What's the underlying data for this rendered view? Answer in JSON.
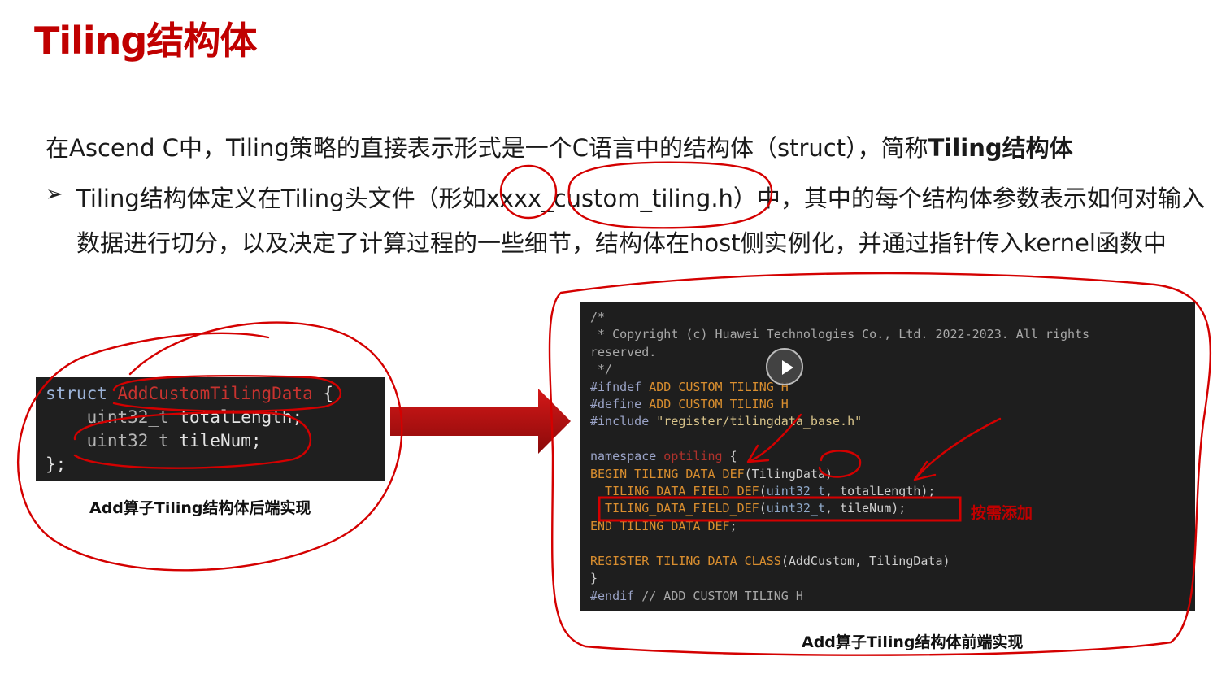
{
  "title": "Tiling结构体",
  "intro": {
    "prefix": "在Ascend C中，Tiling策略的直接表示形式是一个C语言中的结构体（struct），简称",
    "bold": "Tiling结构体"
  },
  "bullet": {
    "mark": "➢",
    "text": "Tiling结构体定义在Tiling头文件（形如xxxx_custom_tiling.h）中，其中的每个结构体参数表示如何对输入数据进行切分，以及决定了计算过程的一些细节，结构体在host侧实例化，并通过指针传入kernel函数中"
  },
  "left_code": {
    "line1_kw": "struct",
    "line1_name": "AddCustomTilingData",
    "line1_brace": " {",
    "line2_type": "uint32_t",
    "line2_field": " totalLength;",
    "line3_type": "uint32_t",
    "line3_field": " tileNum;",
    "line4": "};",
    "caption": "Add算子Tiling结构体后端实现"
  },
  "right_code": {
    "c1": "/*",
    "c2": " * Copyright (c) Huawei Technologies Co., Ltd. 2022-2023. All rights",
    "c3": "reserved.",
    "c4": " */",
    "ifndef_kw": "#ifndef",
    "ifndef_val": " ADD_CUSTOM_TILING_H",
    "define_kw": "#define",
    "define_val": " ADD_CUSTOM_TILING_H",
    "include_kw": "#include",
    "include_val": " \"register/tilingdata_base.h\"",
    "ns_kw": "namespace",
    "ns_name": " optiling",
    "ns_brace": " {",
    "begin_mac": "BEGIN_TILING_DATA_DEF",
    "begin_arg": "(TilingData)",
    "f1_mac": "  TILING_DATA_FIELD_DEF",
    "f1_open": "(",
    "f1_type": "uint32_t",
    "f1_rest": ", totalLength);",
    "f2_mac": "  TILING_DATA_FIELD_DEF",
    "f2_open": "(",
    "f2_type": "uint32_t",
    "f2_rest": ", tileNum);",
    "end_mac": "END_TILING_DATA_DEF",
    "end_rest": ";",
    "reg_mac": "REGISTER_TILING_DATA_CLASS",
    "reg_arg": "(AddCustom, TilingData)",
    "close": "}",
    "endif_kw": "#endif",
    "endif_rest": " // ADD_CUSTOM_TILING_H",
    "note": "按需添加",
    "caption": "Add算子Tiling结构体前端实现"
  },
  "colors": {
    "title": "#c00000",
    "annotation": "#cc0000",
    "code_bg": "#1e1e1e",
    "arrow": "#b01010"
  },
  "icons": [
    "play-icon",
    "arrow-right-icon",
    "bullet-arrow-icon"
  ]
}
